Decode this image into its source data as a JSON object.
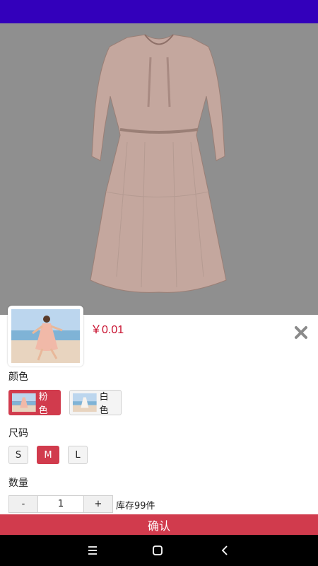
{
  "product": {
    "price": "￥0.01"
  },
  "sections": {
    "color_label": "颜色",
    "size_label": "尺码",
    "quantity_label": "数量"
  },
  "colors": [
    {
      "label": "粉色",
      "selected": true
    },
    {
      "label": "白色",
      "selected": false
    }
  ],
  "sizes": [
    {
      "label": "S",
      "selected": false
    },
    {
      "label": "M",
      "selected": true
    },
    {
      "label": "L",
      "selected": false
    }
  ],
  "quantity": {
    "minus": "-",
    "value": "1",
    "plus": "+",
    "stock": "库存99件"
  },
  "confirm_label": "确认",
  "theme": {
    "accent": "#d13b4d",
    "price_color": "#c8102e",
    "status_bar": "#3300bb"
  },
  "icons": {
    "close": "close-icon",
    "nav_menu": "menu-icon",
    "nav_home": "home-icon",
    "nav_back": "back-icon"
  }
}
